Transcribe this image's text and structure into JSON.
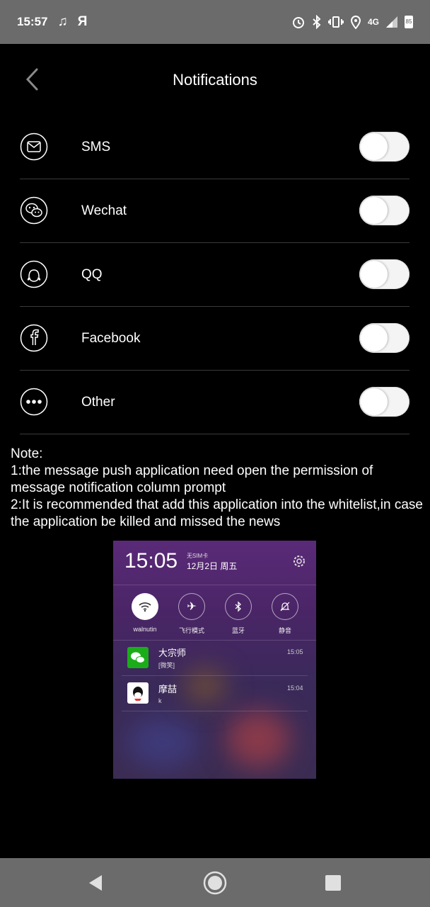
{
  "status_bar": {
    "time": "15:57",
    "ya_icon": "Я",
    "network": "4G",
    "battery": "85"
  },
  "header": {
    "title": "Notifications"
  },
  "notifications": [
    {
      "label": "SMS",
      "icon": "mail-icon",
      "enabled": false
    },
    {
      "label": "Wechat",
      "icon": "wechat-icon",
      "enabled": false
    },
    {
      "label": "QQ",
      "icon": "qq-icon",
      "enabled": false
    },
    {
      "label": "Facebook",
      "icon": "facebook-icon",
      "enabled": false
    },
    {
      "label": "Other",
      "icon": "more-icon",
      "enabled": false
    }
  ],
  "note": {
    "heading": "Note:",
    "line1": "1:the message push application need open the permission of message notification column prompt",
    "line2": "2:It is recommended that add this application into the whitelist,in case the application be killed and missed the news"
  },
  "preview": {
    "time": "15:05",
    "sim": "无SIM卡",
    "date": "12月2日 周五",
    "quick_settings": [
      "walnutin",
      "飞行模式",
      "蓝牙",
      "静音"
    ],
    "notifications": [
      {
        "title": "大宗师",
        "subtitle": "[微笑]",
        "time": "15:05",
        "app": "wechat"
      },
      {
        "title": "摩喆",
        "subtitle": "k",
        "time": "15:04",
        "app": "qq"
      }
    ]
  },
  "colors": {
    "background": "#000000",
    "system_bars": "#6b6b6b",
    "toggle_off": "#f4f4f4",
    "wechat_green": "#1aad19"
  }
}
